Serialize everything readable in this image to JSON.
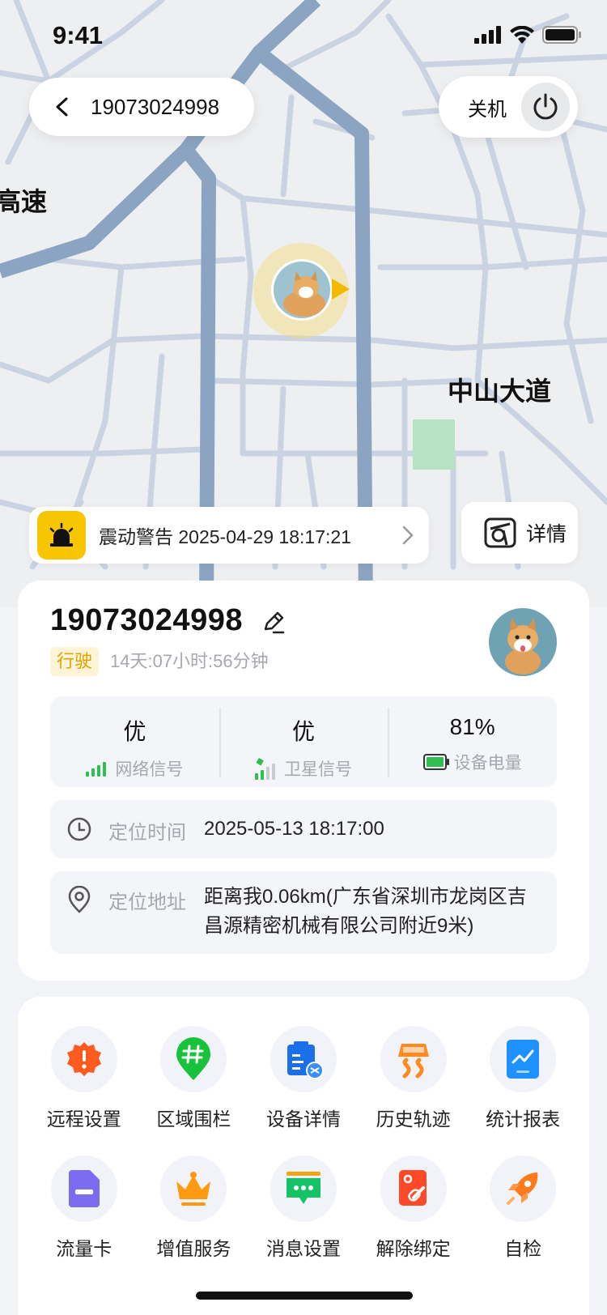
{
  "status_bar": {
    "time": "9:41"
  },
  "header": {
    "device_id": "19073024998",
    "power_label": "关机"
  },
  "map": {
    "label_highway": "高速",
    "label_road": "中山大道"
  },
  "alert": {
    "text": "震动警告 2025-04-29 18:17:21"
  },
  "detail_button": {
    "label": "详情"
  },
  "device": {
    "name": "19073024998",
    "status_tag": "行驶",
    "duration": "14天:07小时:56分钟"
  },
  "stats": [
    {
      "value": "优",
      "label": "网络信号",
      "icon": "network-signal-icon"
    },
    {
      "value": "优",
      "label": "卫星信号",
      "icon": "satellite-signal-icon"
    },
    {
      "value": "81%",
      "label": "设备电量",
      "icon": "battery-icon"
    }
  ],
  "location": {
    "time_label": "定位时间",
    "time_value": "2025-05-13 18:17:00",
    "addr_label": "定位地址",
    "addr_value": "距离我0.06km(广东省深圳市龙岗区吉昌源精密机械有限公司附近9米)"
  },
  "menu": [
    {
      "label": "远程设置",
      "icon": "remote-settings-icon",
      "color": "#ff5a1f"
    },
    {
      "label": "区域围栏",
      "icon": "geofence-icon",
      "color": "#18c23a"
    },
    {
      "label": "设备详情",
      "icon": "device-detail-icon",
      "color": "#1b6fe8"
    },
    {
      "label": "历史轨迹",
      "icon": "history-track-icon",
      "color": "#ff8a1f"
    },
    {
      "label": "统计报表",
      "icon": "statistics-icon",
      "color": "#1e90ff"
    },
    {
      "label": "流量卡",
      "icon": "data-card-icon",
      "color": "#7b6cf0"
    },
    {
      "label": "增值服务",
      "icon": "crown-icon",
      "color": "#ff9a10"
    },
    {
      "label": "消息设置",
      "icon": "message-icon",
      "color": "#16c266"
    },
    {
      "label": "解除绑定",
      "icon": "unbind-icon",
      "color": "#ff4a2a"
    },
    {
      "label": "自检",
      "icon": "rocket-icon",
      "color": "#ff7a1a"
    }
  ]
}
